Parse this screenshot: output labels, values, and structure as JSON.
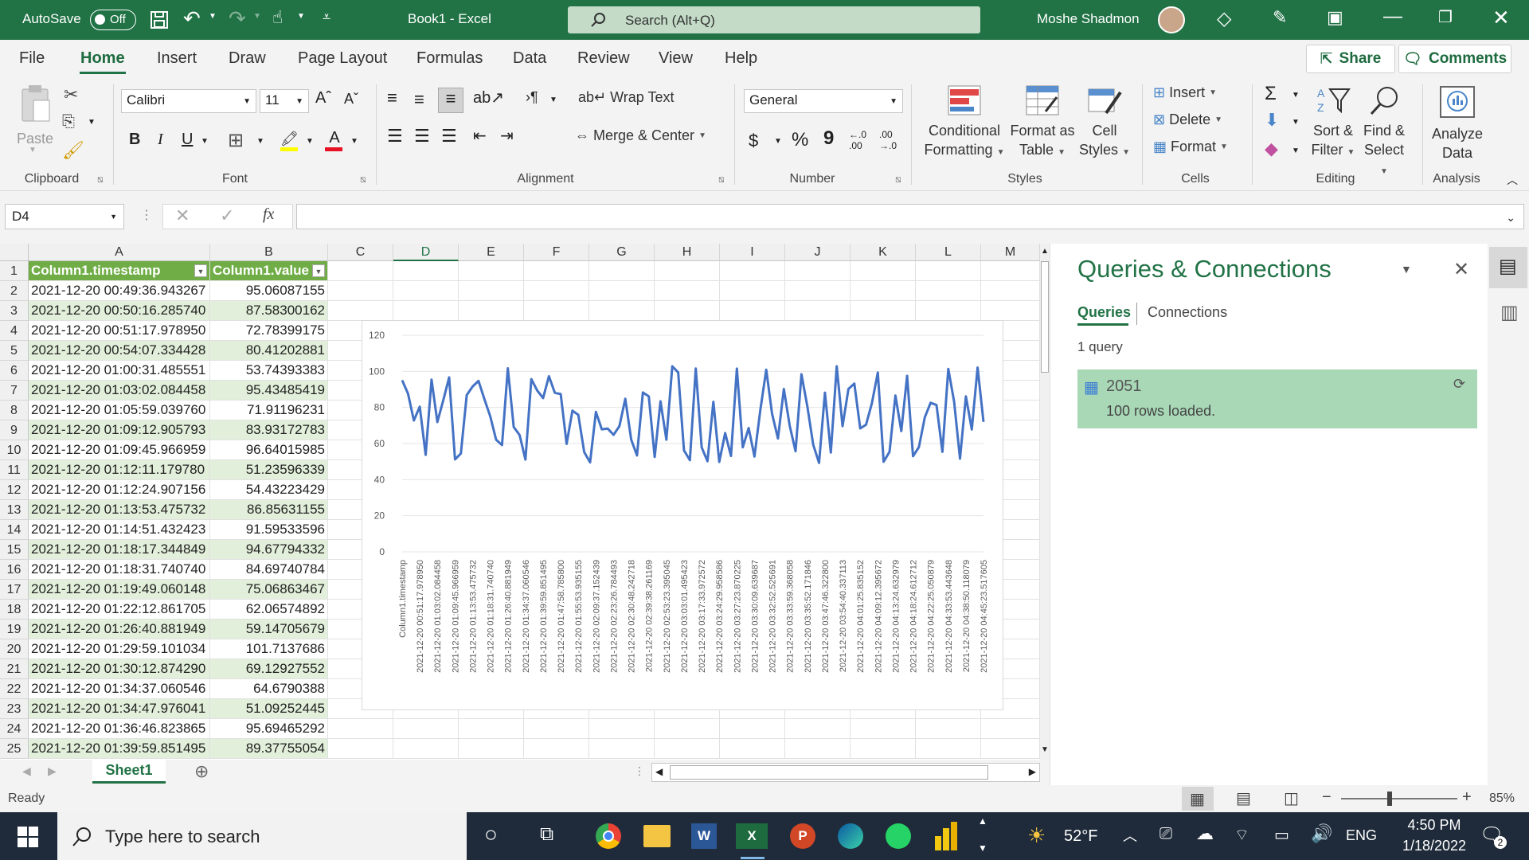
{
  "title_bar": {
    "autosave_label": "AutoSave",
    "autosave_state": "Off",
    "doc_title": "Book1 - Excel",
    "search_placeholder": "Search (Alt+Q)",
    "user_name": "Moshe Shadmon"
  },
  "menu": {
    "tabs": [
      "File",
      "Home",
      "Insert",
      "Draw",
      "Page Layout",
      "Formulas",
      "Data",
      "Review",
      "View",
      "Help"
    ],
    "share": "Share",
    "comments": "Comments"
  },
  "ribbon": {
    "clipboard": {
      "label": "Clipboard",
      "paste": "Paste"
    },
    "font": {
      "label": "Font",
      "name": "Calibri",
      "size": "11",
      "bold": "B",
      "italic": "I",
      "underline": "U",
      "grow": "A^",
      "shrink": "A˅",
      "font_color_glyph": "A"
    },
    "alignment": {
      "label": "Alignment",
      "wrap": "Wrap Text",
      "merge": "Merge & Center"
    },
    "number": {
      "label": "Number",
      "format": "General",
      "currency": "$",
      "percent": "%",
      "comma": "9",
      "inc_dec": "←.0 .00",
      "dec_dec": ".00 →.0"
    },
    "styles": {
      "label": "Styles",
      "cond1": "Conditional",
      "cond2": "Formatting",
      "fat1": "Format as",
      "fat2": "Table",
      "cs1": "Cell",
      "cs2": "Styles"
    },
    "cells": {
      "label": "Cells",
      "insert": "Insert",
      "delete": "Delete",
      "format": "Format"
    },
    "editing": {
      "label": "Editing",
      "sort1": "Sort &",
      "sort2": "Filter",
      "find1": "Find &",
      "find2": "Select",
      "sum": "Σ"
    },
    "analysis": {
      "label": "Analysis",
      "a1": "Analyze",
      "a2": "Data"
    }
  },
  "formula_bar": {
    "name_box": "D4",
    "fx": "fx",
    "value": ""
  },
  "columns": [
    "A",
    "B",
    "C",
    "D",
    "E",
    "F",
    "G",
    "H",
    "I",
    "J",
    "K",
    "L",
    "M"
  ],
  "headers": {
    "a": "Column1.timestamp",
    "b": "Column1.value"
  },
  "rows": [
    {
      "n": "1"
    },
    {
      "n": "2",
      "a": "2021-12-20 00:49:36.943267",
      "b": "95.06087155"
    },
    {
      "n": "3",
      "a": "2021-12-20 00:50:16.285740",
      "b": "87.58300162"
    },
    {
      "n": "4",
      "a": "2021-12-20 00:51:17.978950",
      "b": "72.78399175"
    },
    {
      "n": "5",
      "a": "2021-12-20 00:54:07.334428",
      "b": "80.41202881"
    },
    {
      "n": "6",
      "a": "2021-12-20 01:00:31.485551",
      "b": "53.74393383"
    },
    {
      "n": "7",
      "a": "2021-12-20 01:03:02.084458",
      "b": "95.43485419"
    },
    {
      "n": "8",
      "a": "2021-12-20 01:05:59.039760",
      "b": "71.91196231"
    },
    {
      "n": "9",
      "a": "2021-12-20 01:09:12.905793",
      "b": "83.93172783"
    },
    {
      "n": "10",
      "a": "2021-12-20 01:09:45.966959",
      "b": "96.64015985"
    },
    {
      "n": "11",
      "a": "2021-12-20 01:12:11.179780",
      "b": "51.23596339"
    },
    {
      "n": "12",
      "a": "2021-12-20 01:12:24.907156",
      "b": "54.43223429"
    },
    {
      "n": "13",
      "a": "2021-12-20 01:13:53.475732",
      "b": "86.85631155"
    },
    {
      "n": "14",
      "a": "2021-12-20 01:14:51.432423",
      "b": "91.59533596"
    },
    {
      "n": "15",
      "a": "2021-12-20 01:18:17.344849",
      "b": "94.67794332"
    },
    {
      "n": "16",
      "a": "2021-12-20 01:18:31.740740",
      "b": "84.69740784"
    },
    {
      "n": "17",
      "a": "2021-12-20 01:19:49.060148",
      "b": "75.06863467"
    },
    {
      "n": "18",
      "a": "2021-12-20 01:22:12.861705",
      "b": "62.06574892"
    },
    {
      "n": "19",
      "a": "2021-12-20 01:26:40.881949",
      "b": "59.14705679"
    },
    {
      "n": "20",
      "a": "2021-12-20 01:29:59.101034",
      "b": "101.7137686"
    },
    {
      "n": "21",
      "a": "2021-12-20 01:30:12.874290",
      "b": "69.12927552"
    },
    {
      "n": "22",
      "a": "2021-12-20 01:34:37.060546",
      "b": "64.6790388"
    },
    {
      "n": "23",
      "a": "2021-12-20 01:34:47.976041",
      "b": "51.09252445"
    },
    {
      "n": "24",
      "a": "2021-12-20 01:36:46.823865",
      "b": "95.69465292"
    },
    {
      "n": "25",
      "a": "2021-12-20 01:39:59.851495",
      "b": "89.37755054"
    }
  ],
  "chart_data": {
    "type": "line",
    "ylim": [
      0,
      120
    ],
    "yticks": [
      "0",
      "20",
      "40",
      "60",
      "80",
      "100",
      "120"
    ],
    "xlabel_first": "Column1.timestamp",
    "xticks": [
      "2021-12-20 00:51:17.978950",
      "2021-12-20 01:03:02.084458",
      "2021-12-20 01:09:45.966959",
      "2021-12-20 01:13:53.475732",
      "2021-12-20 01:18:31.740740",
      "2021-12-20 01:26:40.881949",
      "2021-12-20 01:34:37.060546",
      "2021-12-20 01:39:59.851495",
      "2021-12-20 01:47:58.785800",
      "2021-12-20 01:55:53.935155",
      "2021-12-20 02:09:37.152439",
      "2021-12-20 02:23:26.784493",
      "2021-12-20 02:30:48.242718",
      "2021-12-20 02:39:38.261169",
      "2021-12-20 02:53:23.395045",
      "2021-12-20 03:03:01.495423",
      "2021-12-20 03:17:33.972572",
      "2021-12-20 03:24:29.958586",
      "2021-12-20 03:27:23.870225",
      "2021-12-20 03:30:09.639687",
      "2021-12-20 03:32:52.525691",
      "2021-12-20 03:33:59.368058",
      "2021-12-20 03:35:52.171846",
      "2021-12-20 03:47:46.322800",
      "2021-12-20 03:54:40.337113",
      "2021-12-20 04:01:25.835152",
      "2021-12-20 04:09:12.395672",
      "2021-12-20 04:13:24.632979",
      "2021-12-20 04:18:24.612712",
      "2021-12-20 04:22:25.050879",
      "2021-12-20 04:33:53.443648",
      "2021-12-20 04:38:50.118079",
      "2021-12-20 04:45:23.517605"
    ],
    "values": [
      95.06,
      87.58,
      72.78,
      80.41,
      53.74,
      95.43,
      71.91,
      83.93,
      96.64,
      51.24,
      54.43,
      86.86,
      91.6,
      94.68,
      84.7,
      75.07,
      62.07,
      59.15,
      101.71,
      69.13,
      64.68,
      51.09,
      95.69,
      89.38,
      85.2,
      97.3,
      88.1,
      87.4,
      59.8,
      78.2,
      75.9,
      55.3,
      49.6,
      77.5,
      67.9,
      68.3,
      64.8,
      69.6,
      84.8,
      62.2,
      53.4,
      88.3,
      86.1,
      52.6,
      83.4,
      62.1,
      102.8,
      99.4,
      56.2,
      50.8,
      101.6,
      57.9,
      50.2,
      83.1,
      49.8,
      65.8,
      53.1,
      101.5,
      57.9,
      68.6,
      52.8,
      78.7,
      100.9,
      76.5,
      62.8,
      90.2,
      69.8,
      55.7,
      98.4,
      80.6,
      59.3,
      49.3,
      88.2,
      55.0,
      102.8,
      69.6,
      90.2,
      93.2,
      68.4,
      70.4,
      82.4,
      99.3,
      49.9,
      55.4,
      86.6,
      66.9,
      97.5,
      53.0,
      58.0,
      74.5,
      82.6,
      81.3,
      55.4,
      101.4,
      83.2,
      51.6,
      86.1,
      67.8,
      102.1,
      72.0
    ]
  },
  "qc": {
    "title": "Queries & Connections",
    "tab_queries": "Queries",
    "tab_connections": "Connections",
    "count": "1 query",
    "query_name": "2051",
    "query_status": "100 rows loaded."
  },
  "sheet": {
    "name": "Sheet1"
  },
  "status": {
    "ready": "Ready",
    "zoom": "85%"
  },
  "taskbar": {
    "search": "Type here to search",
    "weather": "52°F",
    "lang": "ENG",
    "time": "4:50 PM",
    "date": "1/18/2022",
    "notif": "2"
  }
}
